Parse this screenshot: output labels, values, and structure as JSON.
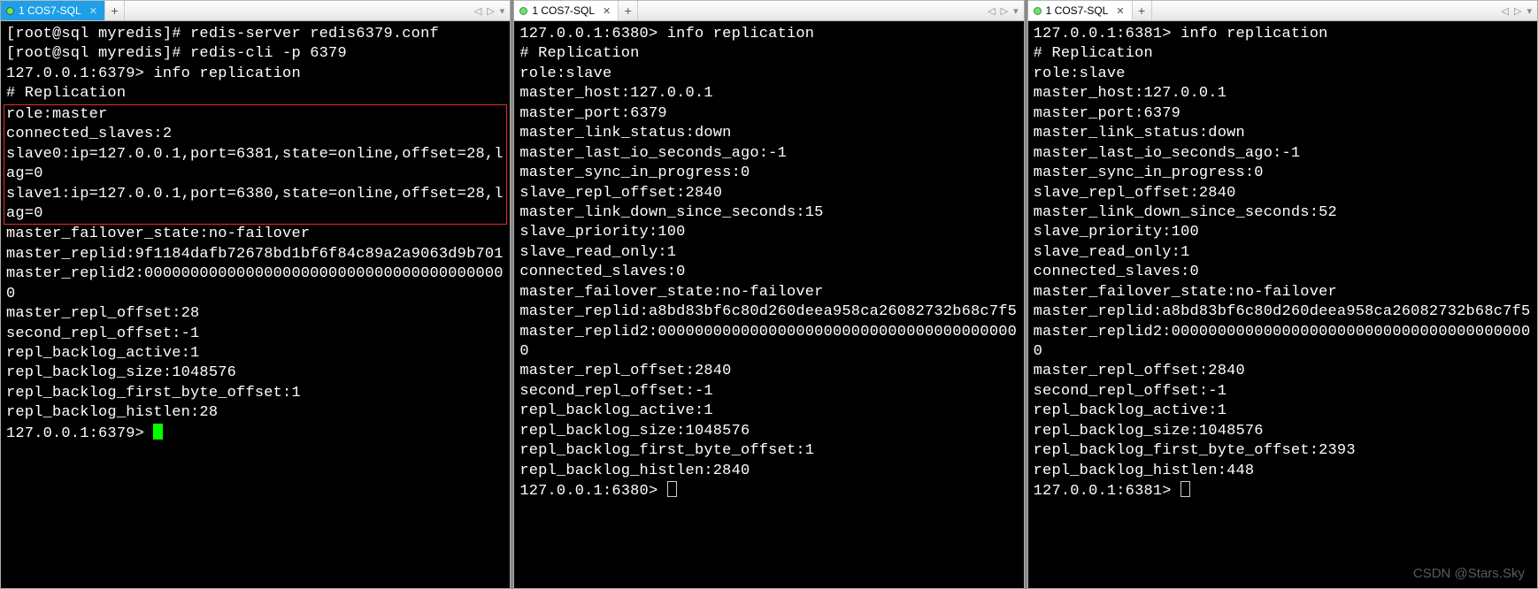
{
  "tab_label": "1 COS7-SQL",
  "watermark": "CSDN @Stars.Sky",
  "pane1": {
    "pre_lines": "[root@sql myredis]# redis-server redis6379.conf\n[root@sql myredis]# redis-cli -p 6379\n127.0.0.1:6379> info replication\n# Replication",
    "box_lines": "role:master\nconnected_slaves:2\nslave0:ip=127.0.0.1,port=6381,state=online,offset=28,lag=0\nslave1:ip=127.0.0.1,port=6380,state=online,offset=28,lag=0",
    "post_lines": "master_failover_state:no-failover\nmaster_replid:9f1184dafb72678bd1bf6f84c89a2a9063d9b701\nmaster_replid2:0000000000000000000000000000000000000000\nmaster_repl_offset:28\nsecond_repl_offset:-1\nrepl_backlog_active:1\nrepl_backlog_size:1048576\nrepl_backlog_first_byte_offset:1\nrepl_backlog_histlen:28",
    "prompt": "127.0.0.1:6379> "
  },
  "pane2": {
    "lines": "127.0.0.1:6380> info replication\n# Replication\nrole:slave\nmaster_host:127.0.0.1\nmaster_port:6379\nmaster_link_status:down\nmaster_last_io_seconds_ago:-1\nmaster_sync_in_progress:0\nslave_repl_offset:2840\nmaster_link_down_since_seconds:15\nslave_priority:100\nslave_read_only:1\nconnected_slaves:0\nmaster_failover_state:no-failover\nmaster_replid:a8bd83bf6c80d260deea958ca26082732b68c7f5\nmaster_replid2:0000000000000000000000000000000000000000\nmaster_repl_offset:2840\nsecond_repl_offset:-1\nrepl_backlog_active:1\nrepl_backlog_size:1048576\nrepl_backlog_first_byte_offset:1\nrepl_backlog_histlen:2840",
    "prompt": "127.0.0.1:6380> "
  },
  "pane3": {
    "lines": "127.0.0.1:6381> info replication\n# Replication\nrole:slave\nmaster_host:127.0.0.1\nmaster_port:6379\nmaster_link_status:down\nmaster_last_io_seconds_ago:-1\nmaster_sync_in_progress:0\nslave_repl_offset:2840\nmaster_link_down_since_seconds:52\nslave_priority:100\nslave_read_only:1\nconnected_slaves:0\nmaster_failover_state:no-failover\nmaster_replid:a8bd83bf6c80d260deea958ca26082732b68c7f5\nmaster_replid2:0000000000000000000000000000000000000000\nmaster_repl_offset:2840\nsecond_repl_offset:-1\nrepl_backlog_active:1\nrepl_backlog_size:1048576\nrepl_backlog_first_byte_offset:2393\nrepl_backlog_histlen:448",
    "prompt": "127.0.0.1:6381> "
  }
}
